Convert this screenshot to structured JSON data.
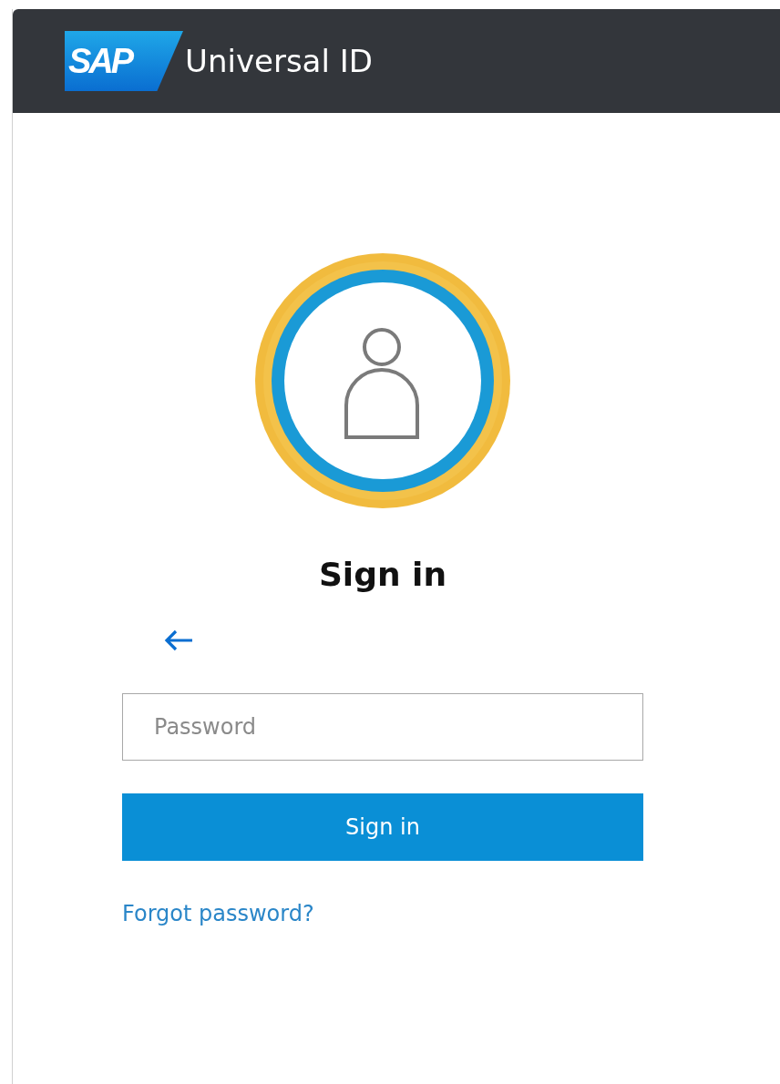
{
  "header": {
    "logo": "SAP",
    "title": "Universal ID"
  },
  "heading": "Sign in",
  "password_field": {
    "placeholder": "Password"
  },
  "sign_in_button": "Sign in",
  "forgot_link": "Forgot password?"
}
